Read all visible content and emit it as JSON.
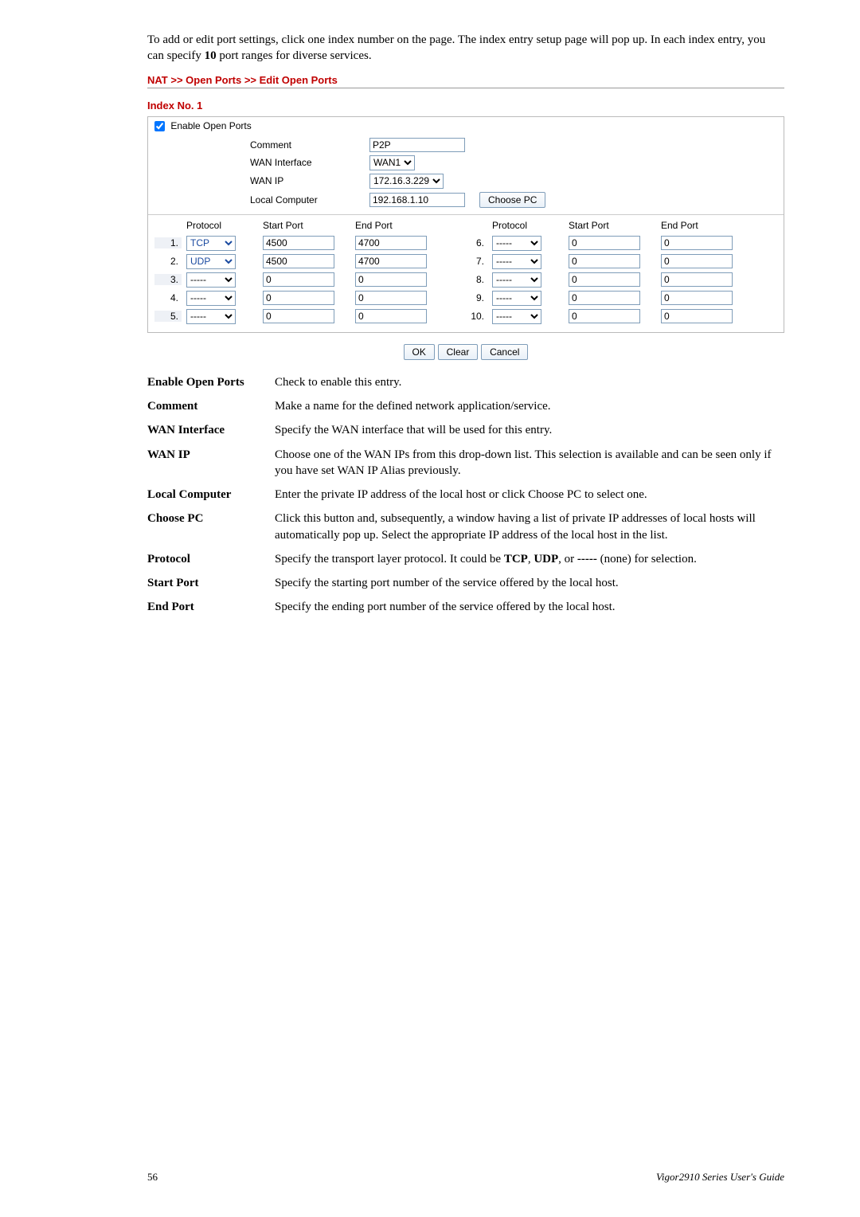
{
  "intro_html": "To add or edit port settings, click one index number on the page. The index entry setup page will pop up. In each index entry, you can specify <b>10</b> port ranges for diverse services.",
  "panel_breadcrumb": "NAT >> Open Ports >> Edit Open Ports",
  "section": "Index No. 1",
  "checkbox_label": "Enable Open Ports",
  "kv": {
    "comment_label": "Comment",
    "comment_value": "P2P",
    "wanif_label": "WAN Interface",
    "wanif_value": "WAN1",
    "wanip_label": "WAN IP",
    "wanip_value": "172.16.3.229",
    "local_label": "Local Computer",
    "local_value": "192.168.1.10",
    "choose_pc": "Choose PC"
  },
  "table": {
    "hdr_protocol": "Protocol",
    "hdr_start": "Start Port",
    "hdr_end": "End Port",
    "rows": [
      {
        "n": "1.",
        "proto": "TCP",
        "sp": "4500",
        "ep": "4700",
        "n2": "6.",
        "proto2": "-----",
        "sp2": "0",
        "ep2": "0"
      },
      {
        "n": "2.",
        "proto": "UDP",
        "sp": "4500",
        "ep": "4700",
        "n2": "7.",
        "proto2": "-----",
        "sp2": "0",
        "ep2": "0"
      },
      {
        "n": "3.",
        "proto": "-----",
        "sp": "0",
        "ep": "0",
        "n2": "8.",
        "proto2": "-----",
        "sp2": "0",
        "ep2": "0"
      },
      {
        "n": "4.",
        "proto": "-----",
        "sp": "0",
        "ep": "0",
        "n2": "9.",
        "proto2": "-----",
        "sp2": "0",
        "ep2": "0"
      },
      {
        "n": "5.",
        "proto": "-----",
        "sp": "0",
        "ep": "0",
        "n2": "10.",
        "proto2": "-----",
        "sp2": "0",
        "ep2": "0"
      }
    ]
  },
  "buttons": {
    "ok": "OK",
    "clear": "Clear",
    "cancel": "Cancel"
  },
  "defs": [
    {
      "t": "Enable Open Ports",
      "d": "Check to enable this entry."
    },
    {
      "t": "Comment",
      "d": "Make a name for the defined network application/service."
    },
    {
      "t": "WAN Interface",
      "d": "Specify the WAN interface that will be used for this entry."
    },
    {
      "t": "WAN IP",
      "d": "Choose one of the WAN IPs from this drop-down list. This selection is available and can be seen only if you have set WAN IP Alias previously."
    },
    {
      "t": "Local Computer",
      "d": "Enter the private IP address of the local host or click Choose PC to select one."
    },
    {
      "t": "Choose PC",
      "d": "Click this button and, subsequently, a window having a list of private IP addresses of local hosts will automatically pop up. Select the appropriate IP address of the local host in the list."
    },
    {
      "t": "Protocol",
      "d_html": "Specify the transport layer protocol. It could be <b>TCP</b>, <b>UDP</b>, or <b>-----</b> (none) for selection."
    },
    {
      "t": "Start Port",
      "d": "Specify the starting port number of the service offered by the local host."
    },
    {
      "t": "End Port",
      "d": "Specify the ending port number of the service offered by the local host."
    }
  ],
  "footer": {
    "page": "56",
    "guide": "Vigor2910  Series  User's Guide"
  }
}
